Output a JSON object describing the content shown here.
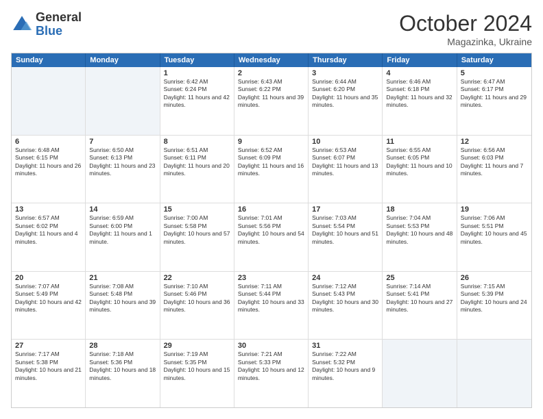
{
  "logo": {
    "general": "General",
    "blue": "Blue"
  },
  "header": {
    "month": "October 2024",
    "location": "Magazinka, Ukraine"
  },
  "weekdays": [
    "Sunday",
    "Monday",
    "Tuesday",
    "Wednesday",
    "Thursday",
    "Friday",
    "Saturday"
  ],
  "weeks": [
    [
      {
        "day": "",
        "info": ""
      },
      {
        "day": "",
        "info": ""
      },
      {
        "day": "1",
        "info": "Sunrise: 6:42 AM\nSunset: 6:24 PM\nDaylight: 11 hours and 42 minutes."
      },
      {
        "day": "2",
        "info": "Sunrise: 6:43 AM\nSunset: 6:22 PM\nDaylight: 11 hours and 39 minutes."
      },
      {
        "day": "3",
        "info": "Sunrise: 6:44 AM\nSunset: 6:20 PM\nDaylight: 11 hours and 35 minutes."
      },
      {
        "day": "4",
        "info": "Sunrise: 6:46 AM\nSunset: 6:18 PM\nDaylight: 11 hours and 32 minutes."
      },
      {
        "day": "5",
        "info": "Sunrise: 6:47 AM\nSunset: 6:17 PM\nDaylight: 11 hours and 29 minutes."
      }
    ],
    [
      {
        "day": "6",
        "info": "Sunrise: 6:48 AM\nSunset: 6:15 PM\nDaylight: 11 hours and 26 minutes."
      },
      {
        "day": "7",
        "info": "Sunrise: 6:50 AM\nSunset: 6:13 PM\nDaylight: 11 hours and 23 minutes."
      },
      {
        "day": "8",
        "info": "Sunrise: 6:51 AM\nSunset: 6:11 PM\nDaylight: 11 hours and 20 minutes."
      },
      {
        "day": "9",
        "info": "Sunrise: 6:52 AM\nSunset: 6:09 PM\nDaylight: 11 hours and 16 minutes."
      },
      {
        "day": "10",
        "info": "Sunrise: 6:53 AM\nSunset: 6:07 PM\nDaylight: 11 hours and 13 minutes."
      },
      {
        "day": "11",
        "info": "Sunrise: 6:55 AM\nSunset: 6:05 PM\nDaylight: 11 hours and 10 minutes."
      },
      {
        "day": "12",
        "info": "Sunrise: 6:56 AM\nSunset: 6:03 PM\nDaylight: 11 hours and 7 minutes."
      }
    ],
    [
      {
        "day": "13",
        "info": "Sunrise: 6:57 AM\nSunset: 6:02 PM\nDaylight: 11 hours and 4 minutes."
      },
      {
        "day": "14",
        "info": "Sunrise: 6:59 AM\nSunset: 6:00 PM\nDaylight: 11 hours and 1 minute."
      },
      {
        "day": "15",
        "info": "Sunrise: 7:00 AM\nSunset: 5:58 PM\nDaylight: 10 hours and 57 minutes."
      },
      {
        "day": "16",
        "info": "Sunrise: 7:01 AM\nSunset: 5:56 PM\nDaylight: 10 hours and 54 minutes."
      },
      {
        "day": "17",
        "info": "Sunrise: 7:03 AM\nSunset: 5:54 PM\nDaylight: 10 hours and 51 minutes."
      },
      {
        "day": "18",
        "info": "Sunrise: 7:04 AM\nSunset: 5:53 PM\nDaylight: 10 hours and 48 minutes."
      },
      {
        "day": "19",
        "info": "Sunrise: 7:06 AM\nSunset: 5:51 PM\nDaylight: 10 hours and 45 minutes."
      }
    ],
    [
      {
        "day": "20",
        "info": "Sunrise: 7:07 AM\nSunset: 5:49 PM\nDaylight: 10 hours and 42 minutes."
      },
      {
        "day": "21",
        "info": "Sunrise: 7:08 AM\nSunset: 5:48 PM\nDaylight: 10 hours and 39 minutes."
      },
      {
        "day": "22",
        "info": "Sunrise: 7:10 AM\nSunset: 5:46 PM\nDaylight: 10 hours and 36 minutes."
      },
      {
        "day": "23",
        "info": "Sunrise: 7:11 AM\nSunset: 5:44 PM\nDaylight: 10 hours and 33 minutes."
      },
      {
        "day": "24",
        "info": "Sunrise: 7:12 AM\nSunset: 5:43 PM\nDaylight: 10 hours and 30 minutes."
      },
      {
        "day": "25",
        "info": "Sunrise: 7:14 AM\nSunset: 5:41 PM\nDaylight: 10 hours and 27 minutes."
      },
      {
        "day": "26",
        "info": "Sunrise: 7:15 AM\nSunset: 5:39 PM\nDaylight: 10 hours and 24 minutes."
      }
    ],
    [
      {
        "day": "27",
        "info": "Sunrise: 7:17 AM\nSunset: 5:38 PM\nDaylight: 10 hours and 21 minutes."
      },
      {
        "day": "28",
        "info": "Sunrise: 7:18 AM\nSunset: 5:36 PM\nDaylight: 10 hours and 18 minutes."
      },
      {
        "day": "29",
        "info": "Sunrise: 7:19 AM\nSunset: 5:35 PM\nDaylight: 10 hours and 15 minutes."
      },
      {
        "day": "30",
        "info": "Sunrise: 7:21 AM\nSunset: 5:33 PM\nDaylight: 10 hours and 12 minutes."
      },
      {
        "day": "31",
        "info": "Sunrise: 7:22 AM\nSunset: 5:32 PM\nDaylight: 10 hours and 9 minutes."
      },
      {
        "day": "",
        "info": ""
      },
      {
        "day": "",
        "info": ""
      }
    ]
  ]
}
